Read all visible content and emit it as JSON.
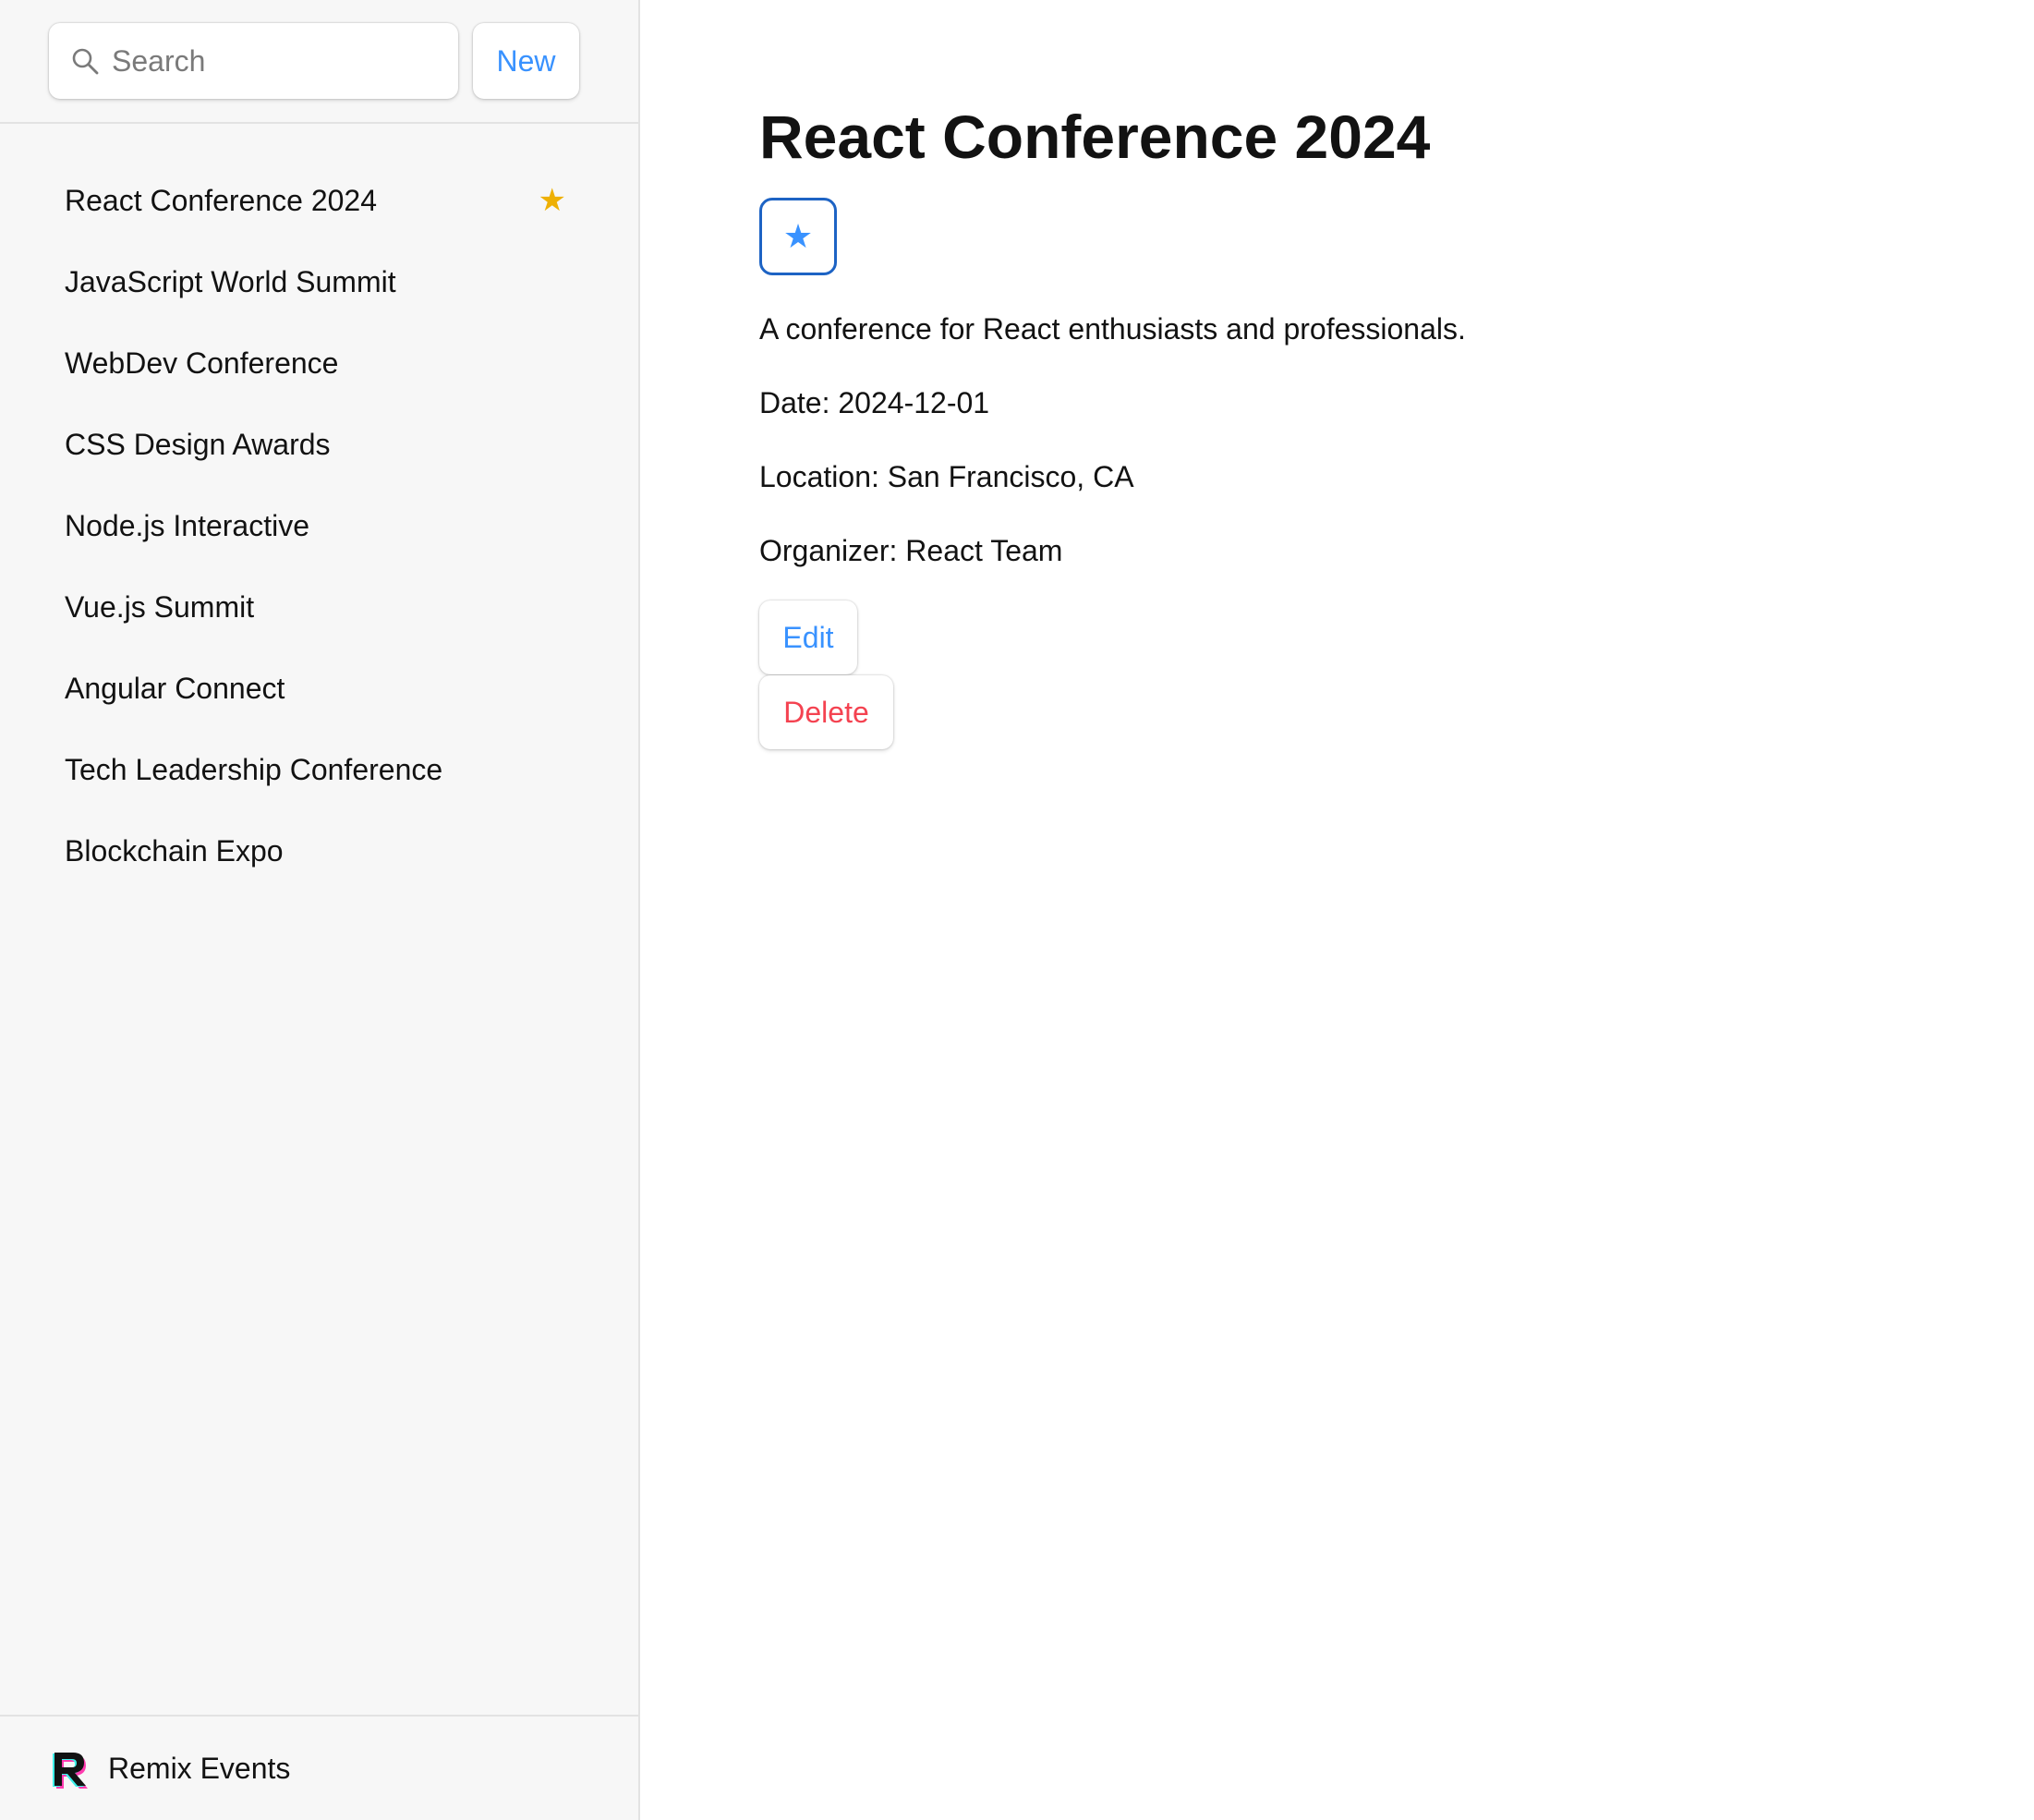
{
  "sidebar": {
    "search": {
      "placeholder": "Search",
      "value": ""
    },
    "new_label": "New",
    "items": [
      {
        "label": "React Conference 2024",
        "favorite": true
      },
      {
        "label": "JavaScript World Summit",
        "favorite": false
      },
      {
        "label": "WebDev Conference",
        "favorite": false
      },
      {
        "label": "CSS Design Awards",
        "favorite": false
      },
      {
        "label": "Node.js Interactive",
        "favorite": false
      },
      {
        "label": "Vue.js Summit",
        "favorite": false
      },
      {
        "label": "Angular Connect",
        "favorite": false
      },
      {
        "label": "Tech Leadership Conference",
        "favorite": false
      },
      {
        "label": "Blockchain Expo",
        "favorite": false
      }
    ],
    "star_glyph": "★",
    "footer": {
      "brand": "Remix Events",
      "logo_icon": "remix-logo-icon"
    }
  },
  "detail": {
    "title": "React Conference 2024",
    "favorite_glyph": "★",
    "description": "A conference for React enthusiasts and professionals.",
    "date": "Date: 2024-12-01",
    "location": "Location: San Francisco, CA",
    "organizer": "Organizer: React Team",
    "edit_label": "Edit",
    "delete_label": "Delete"
  },
  "colors": {
    "accent": "#3992ff",
    "favorite_star": "#eeb004",
    "danger": "#f44250",
    "focus_border": "#1d63c4"
  }
}
